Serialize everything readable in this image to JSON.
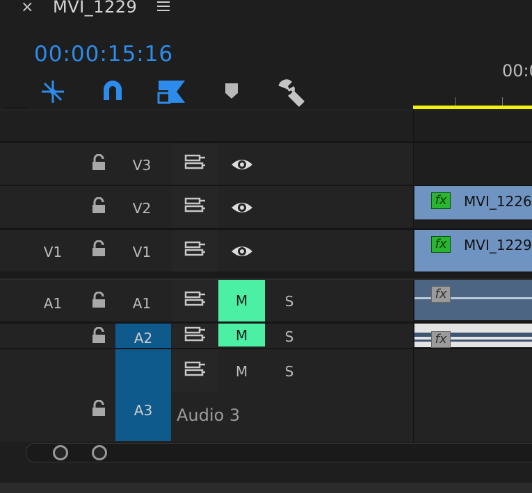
{
  "panel": {
    "close_glyph": "×",
    "sequence_name": "MVI_1229",
    "timecode": "00:00:15:16",
    "ruler_time": "00:0"
  },
  "colors": {
    "accent": "#2d8ceb",
    "playhead_bar": "#f2f20c",
    "mute_on": "#4cf0a4",
    "target_blue": "#0e5a8c",
    "video_clip": "#7094c2",
    "audio_clip": "#4c6583",
    "fx_green": "#29b52d"
  },
  "toolbar": {
    "icons": [
      "nest-snap-icon",
      "snap-magnet-icon",
      "linked-selection-icon",
      "add-marker-icon",
      "timeline-settings-wrench-icon"
    ]
  },
  "tracks": {
    "v3": {
      "name": "V3"
    },
    "v2": {
      "name": "V2"
    },
    "v1": {
      "source": "V1",
      "name": "V1"
    },
    "a1": {
      "source": "A1",
      "name": "A1",
      "mute": "M",
      "solo": "S"
    },
    "a2": {
      "name": "A2",
      "mute": "M",
      "solo": "S"
    },
    "a3": {
      "name": "A3",
      "mute": "M",
      "solo": "S",
      "label": "Audio 3"
    }
  },
  "clips": {
    "v2": {
      "name": "MVI_1226",
      "fx": "fx"
    },
    "v1": {
      "name": "MVI_1229",
      "fx": "fx"
    },
    "a1": {
      "fx": "fx"
    },
    "a2": {
      "fx": "fx"
    }
  }
}
